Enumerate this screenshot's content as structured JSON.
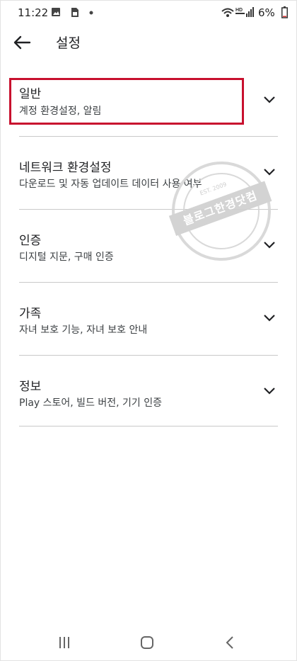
{
  "status_bar": {
    "time": "11:22",
    "battery": "6%",
    "network": "HD",
    "icons": [
      "gallery-icon",
      "sim-icon",
      "dot-icon",
      "wifi-icon",
      "hd-voice-icon",
      "signal-icon",
      "battery-icon"
    ]
  },
  "app_bar": {
    "back_icon": "arrow-left-icon",
    "title": "설정"
  },
  "settings": [
    {
      "label": "일반",
      "subtitle": "계정 환경설정, 알림",
      "highlighted": true
    },
    {
      "label": "네트워크 환경설정",
      "subtitle": "다운로드 및 자동 업데이트 데이터 사용 여부"
    },
    {
      "label": "인증",
      "subtitle": "디지털 지문, 구매 인증"
    },
    {
      "label": "가족",
      "subtitle": "자녀 보호 기능, 자녀 보호 안내"
    },
    {
      "label": "정보",
      "subtitle": "Play 스토어, 빌드 버전, 기기 인증"
    }
  ],
  "watermark": {
    "text": "블로그한경닷컴",
    "est": "EST. 2009"
  },
  "nav_bar": {
    "icons": [
      "recents-icon",
      "home-icon",
      "back-icon"
    ]
  },
  "colors": {
    "highlight": "#c8102e",
    "divider": "#c9c9c9",
    "text": "#202124"
  }
}
